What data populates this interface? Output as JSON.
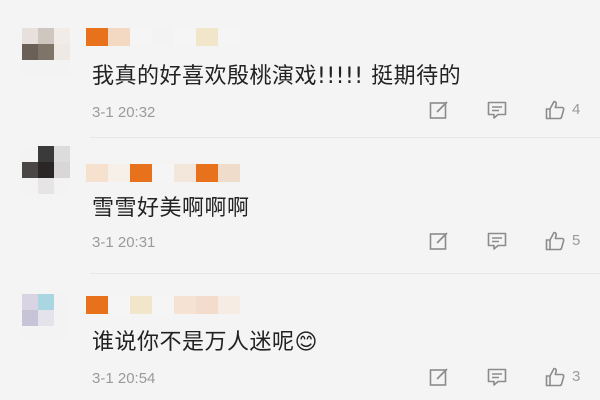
{
  "comments": [
    {
      "text": "我真的好喜欢殷桃演戏!!!!! 挺期待的",
      "time": "3-1 20:32",
      "likes": "4"
    },
    {
      "text": "雪雪好美啊啊啊",
      "time": "3-1 20:31",
      "likes": "5"
    },
    {
      "text": "谁说你不是万人迷呢😊",
      "time": "3-1 20:54",
      "likes": "3"
    }
  ],
  "colors": {
    "background": "#f4f4f4",
    "text": "#222222",
    "meta": "#9a9a9a",
    "icon": "#8c8c8c",
    "nickname_mosaic": "#e8711b"
  },
  "icons": [
    "edit-icon",
    "reply-icon",
    "like-icon"
  ]
}
